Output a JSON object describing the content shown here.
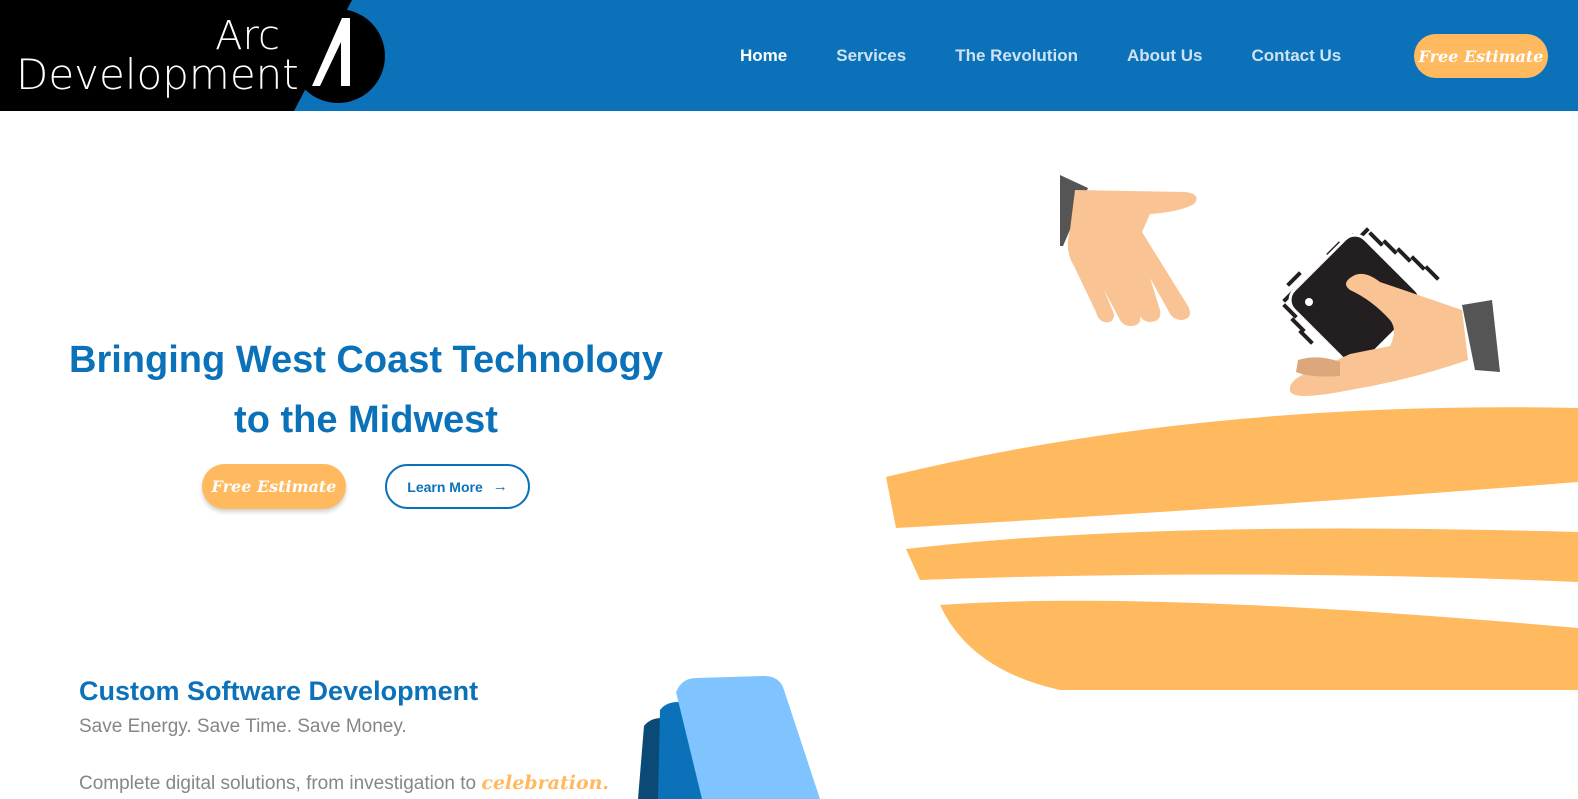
{
  "header": {
    "logo": {
      "line1": "Arc",
      "line2": "Development"
    },
    "tabs": [
      {
        "label": "Home",
        "active": true
      },
      {
        "label": "Services",
        "active": false
      },
      {
        "label": "The Revolution",
        "active": false
      },
      {
        "label": "About Us",
        "active": false
      },
      {
        "label": "Contact Us",
        "active": false
      }
    ],
    "cta_label": "Free Estimate"
  },
  "hero": {
    "title_line1": "Bringing West Coast Technology",
    "title_line2": "to the Midwest",
    "estimate_label": "Free Estimate",
    "learn_more_label": "Learn More",
    "learn_more_icon": "arrow-right-icon"
  },
  "service": {
    "title": "Custom Software Development",
    "subtitle": "Save Energy. Save Time. Save Money.",
    "description_prefix": "Complete digital solutions, from investigation to ",
    "description_accent": "celebration."
  },
  "colors": {
    "primary": "#0b72b9",
    "secondary": "#ffba60",
    "text_muted": "#868686",
    "logo_dark": "#000000"
  }
}
